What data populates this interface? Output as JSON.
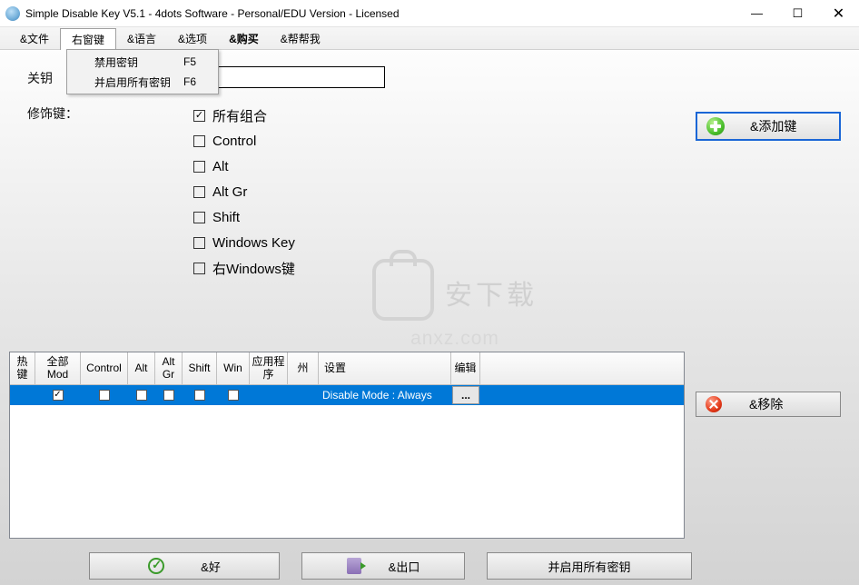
{
  "window": {
    "title": "Simple Disable Key V5.1 - 4dots Software - Personal/EDU Version - Licensed"
  },
  "menu": {
    "file": "&文件",
    "rightwin": "右窗键",
    "language": "&语言",
    "options": "&选项",
    "buy": "&购买",
    "help": "&帮帮我"
  },
  "dropdown": {
    "item1": {
      "label": "禁用密钥",
      "shortcut": "F5"
    },
    "item2": {
      "label": "并启用所有密钥",
      "shortcut": "F6"
    }
  },
  "labels": {
    "key_partial": "关钥",
    "modifiers": "修饰键："
  },
  "mods": {
    "all": "所有组合",
    "control": "Control",
    "alt": "Alt",
    "altgr": "Alt Gr",
    "shift": "Shift",
    "winkey": "Windows Key",
    "rwinkey": "右Windows键"
  },
  "buttons": {
    "add": "&添加键",
    "remove": "&移除",
    "ok": "&好",
    "exit": "&出口",
    "enable_all": "并启用所有密钥"
  },
  "watermark": {
    "cn": "安下载",
    "en": "anxz.com"
  },
  "table": {
    "headers": {
      "hotkey": "热键",
      "allmod": "全部Mod",
      "control": "Control",
      "alt": "Alt",
      "altgr": "Alt Gr",
      "shift": "Shift",
      "win": "Win",
      "app": "应用程序",
      "state": "州",
      "settings": "设置",
      "edit": "编辑"
    },
    "row1": {
      "all_checked": true,
      "settings": "Disable Mode : Always",
      "edit": "..."
    }
  },
  "col_widths": {
    "hotkey": 28,
    "allmod": 50,
    "control": 52,
    "alt": 30,
    "altgr": 30,
    "shift": 38,
    "win": 36,
    "app": 42,
    "state": 34,
    "settings": 146,
    "edit": 32
  }
}
